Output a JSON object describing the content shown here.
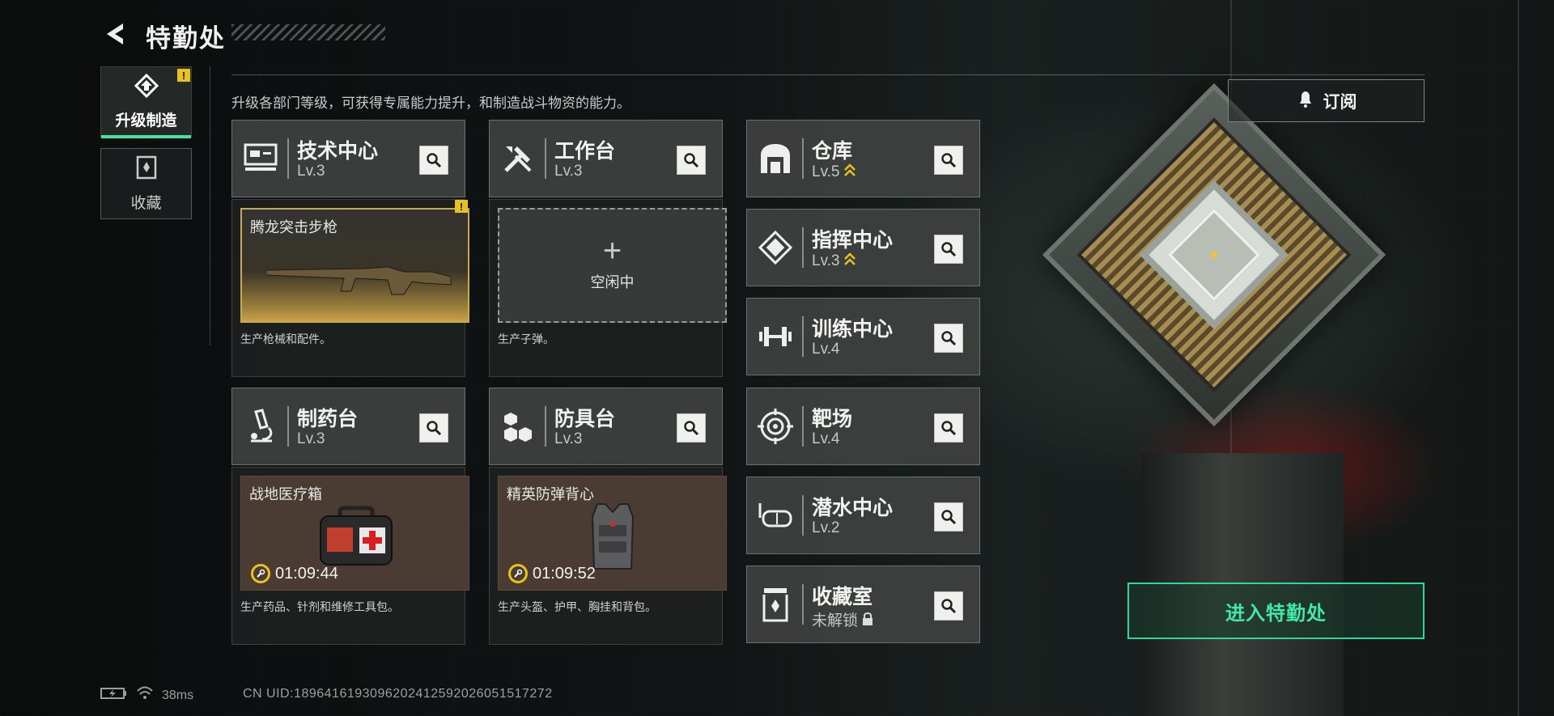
{
  "header": {
    "title": "特勤处",
    "description": "升级各部门等级，可获得专属能力提升，和制造战斗物资的能力。"
  },
  "tabs": [
    {
      "label": "升级制造",
      "active": true,
      "alert": "!"
    },
    {
      "label": "收藏",
      "active": false
    }
  ],
  "departments": {
    "tech": {
      "name": "技术中心",
      "level": "Lv.3",
      "icon": "monitor-icon"
    },
    "workbench": {
      "name": "工作台",
      "level": "Lv.3",
      "icon": "tools-icon"
    },
    "warehouse": {
      "name": "仓库",
      "level": "Lv.5",
      "icon": "warehouse-icon",
      "upgradable": true
    },
    "command": {
      "name": "指挥中心",
      "level": "Lv.3",
      "icon": "command-icon",
      "upgradable": true
    },
    "training": {
      "name": "训练中心",
      "level": "Lv.4",
      "icon": "dumbbell-icon"
    },
    "range": {
      "name": "靶场",
      "level": "Lv.4",
      "icon": "target-icon"
    },
    "pharmacy": {
      "name": "制药台",
      "level": "Lv.3",
      "icon": "microscope-icon"
    },
    "armor": {
      "name": "防具台",
      "level": "Lv.3",
      "icon": "cubes-icon"
    },
    "diving": {
      "name": "潜水中心",
      "level": "Lv.2",
      "icon": "diving-mask-icon"
    },
    "collection": {
      "name": "收藏室",
      "level": "未解锁",
      "icon": "trophy-case-icon",
      "locked": true
    }
  },
  "production": {
    "tech": {
      "item": "腾龙突击步枪",
      "desc": "生产枪械和配件。",
      "alert": "!"
    },
    "workbench": {
      "idle_label": "空闲中",
      "desc": "生产子弹。"
    },
    "pharmacy": {
      "item": "战地医疗箱",
      "timer": "01:09:44",
      "desc": "生产药品、针剂和维修工具包。"
    },
    "armor": {
      "item": "精英防弹背心",
      "timer": "01:09:52",
      "desc": "生产头盔、护甲、胸挂和背包。"
    }
  },
  "actions": {
    "subscribe": "订阅",
    "enter": "进入特勤处"
  },
  "status": {
    "ping": "38ms",
    "uid": "CN UID:1896416193096202412592026051517272"
  },
  "colors": {
    "accent": "#42e6a4",
    "alert": "#e8c21e",
    "gold_frame": "#c8a94e"
  }
}
